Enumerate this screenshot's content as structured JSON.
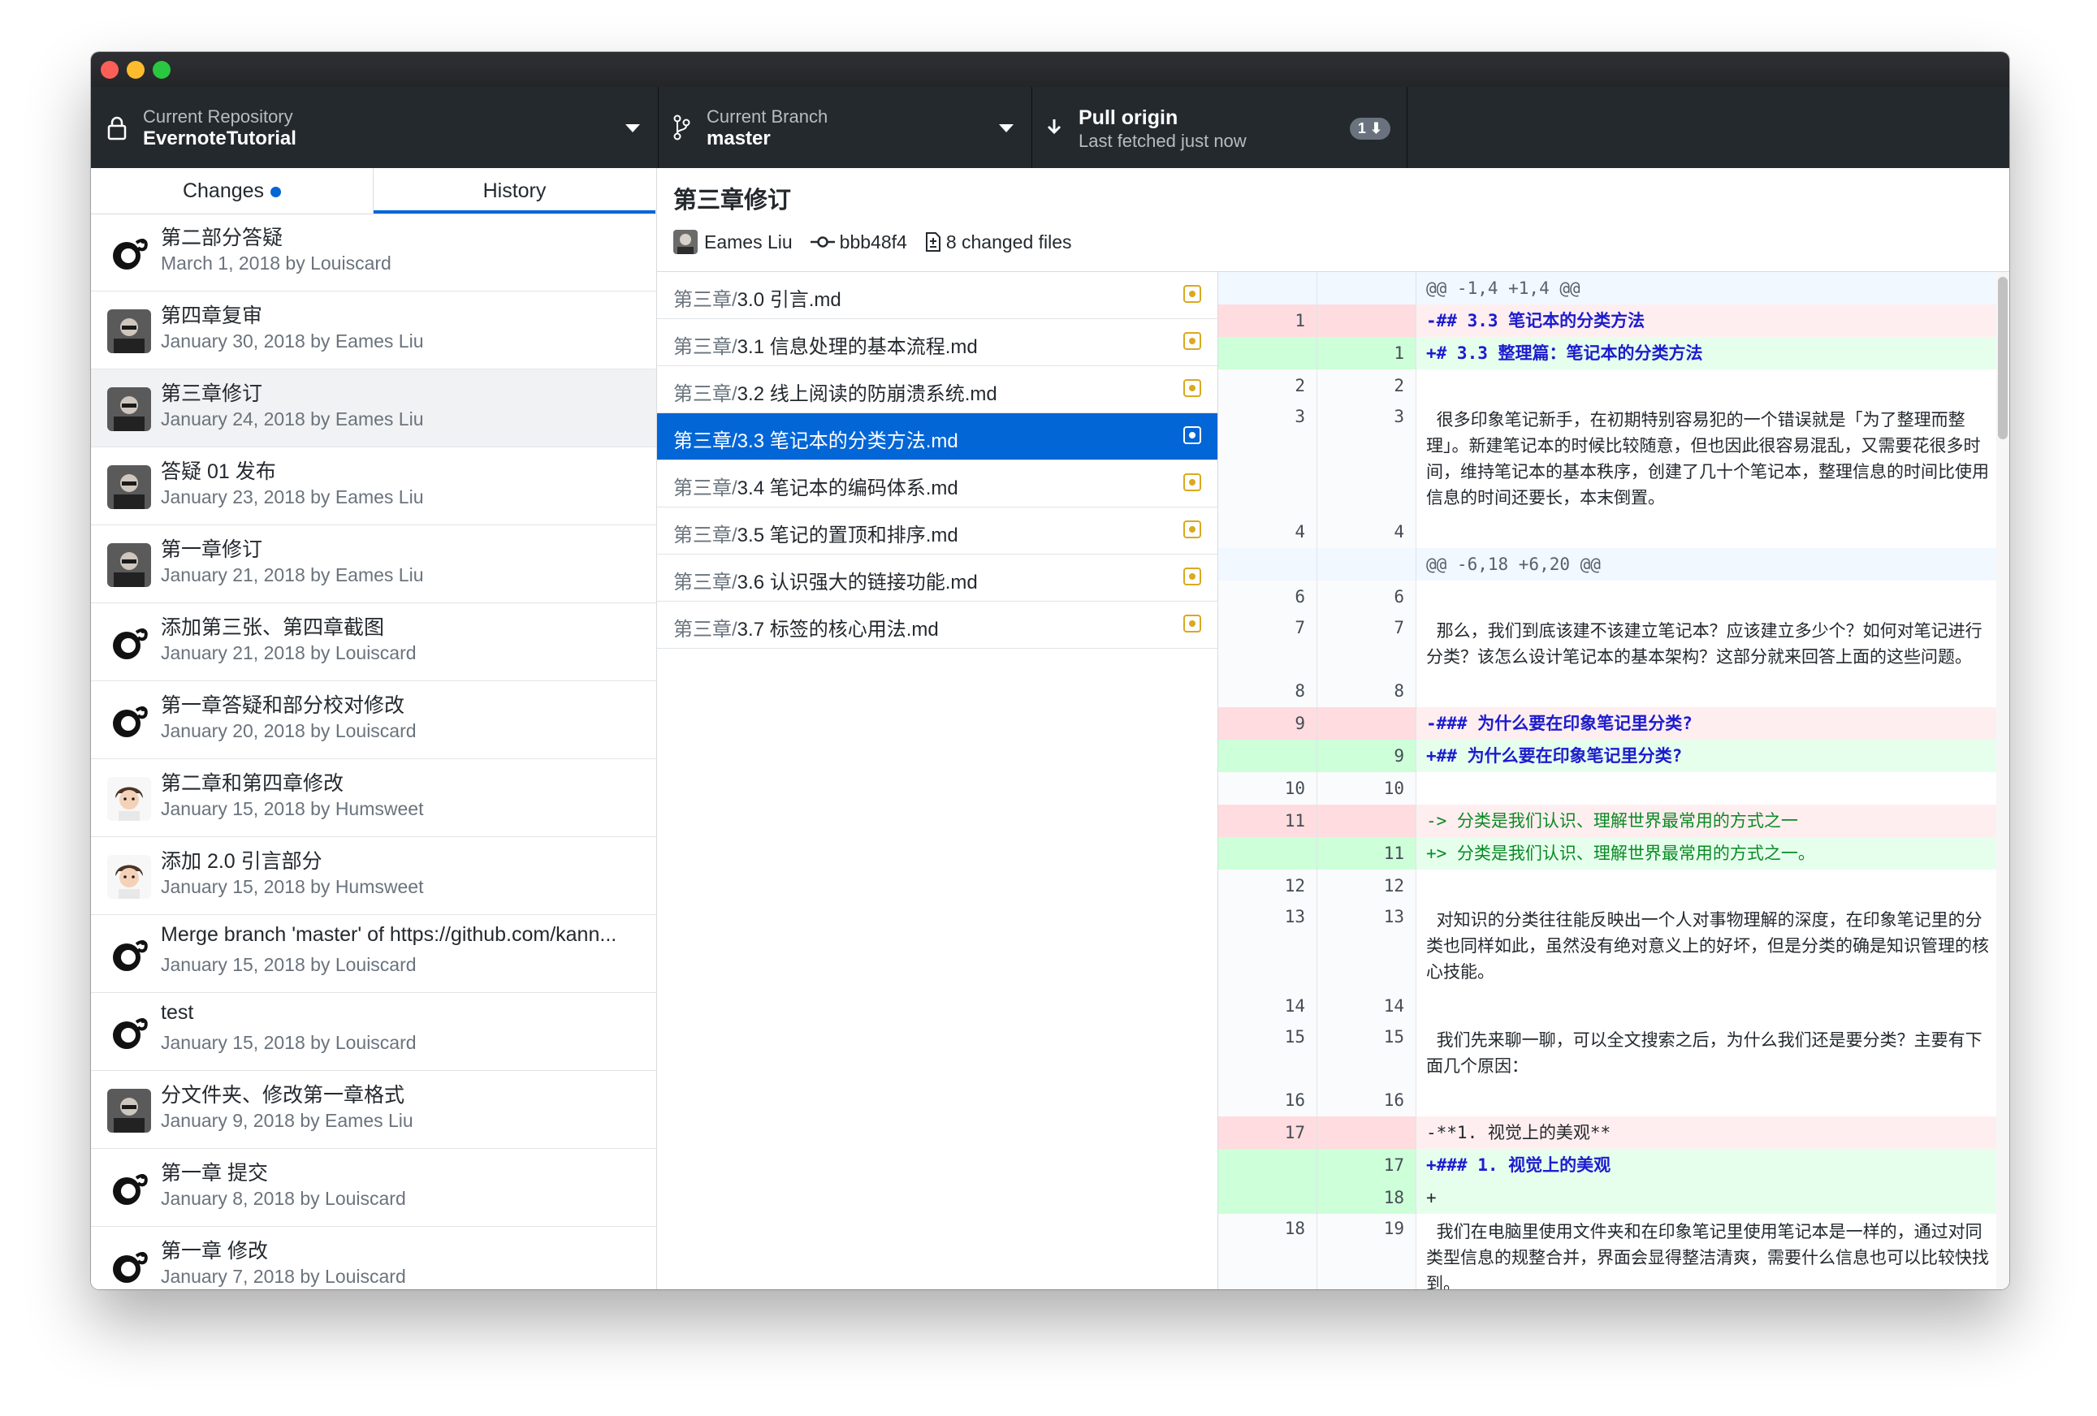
{
  "toolbar": {
    "repo_label": "Current Repository",
    "repo_value": "EvernoteTutorial",
    "branch_label": "Current Branch",
    "branch_value": "master",
    "pull_title": "Pull origin",
    "pull_subtitle": "Last fetched just now",
    "pull_badge": "1"
  },
  "sidebar": {
    "tabs": [
      {
        "label": "Changes"
      },
      {
        "label": "History"
      }
    ],
    "commits": [
      {
        "title": "第二部分答疑",
        "meta": "March 1, 2018 by Louiscard",
        "avatar": "octocat"
      },
      {
        "title": "第四章复审",
        "meta": "January 30, 2018 by Eames Liu",
        "avatar": "photo"
      },
      {
        "title": "第三章修订",
        "meta": "January 24, 2018 by Eames Liu",
        "avatar": "photo"
      },
      {
        "title": "答疑 01 发布",
        "meta": "January 23, 2018 by Eames Liu",
        "avatar": "photo"
      },
      {
        "title": "第一章修订",
        "meta": "January 21, 2018 by Eames Liu",
        "avatar": "photo"
      },
      {
        "title": "添加第三张、第四章截图",
        "meta": "January 21, 2018 by Louiscard",
        "avatar": "octocat"
      },
      {
        "title": "第一章答疑和部分校对修改",
        "meta": "January 20, 2018 by Louiscard",
        "avatar": "octocat"
      },
      {
        "title": "第二章和第四章修改",
        "meta": "January 15, 2018 by Humsweet",
        "avatar": "cartoon"
      },
      {
        "title": "添加 2.0 引言部分",
        "meta": "January 15, 2018 by Humsweet",
        "avatar": "cartoon"
      },
      {
        "title": "Merge branch 'master' of https://github.com/kann...",
        "meta": "January 15, 2018 by Louiscard",
        "avatar": "octocat"
      },
      {
        "title": "test",
        "meta": "January 15, 2018 by Louiscard",
        "avatar": "octocat"
      },
      {
        "title": "分文件夹、修改第一章格式",
        "meta": "January 9, 2018 by Eames Liu",
        "avatar": "photo"
      },
      {
        "title": "第一章 提交",
        "meta": "January 8, 2018 by Louiscard",
        "avatar": "octocat"
      },
      {
        "title": "第一章 修改",
        "meta": "January 7, 2018 by Louiscard",
        "avatar": "octocat"
      }
    ]
  },
  "commit_detail": {
    "title": "第三章修订",
    "author": "Eames Liu",
    "sha": "bbb48f4",
    "changed_files": "8 changed files"
  },
  "files": [
    {
      "dir": "第三章/",
      "name": "3.0 引言.md"
    },
    {
      "dir": "第三章/",
      "name": "3.1 信息处理的基本流程.md"
    },
    {
      "dir": "第三章/",
      "name": "3.2 线上阅读的防崩溃系统.md"
    },
    {
      "dir": "第三章/",
      "name": "3.3 笔记本的分类方法.md"
    },
    {
      "dir": "第三章/",
      "name": "3.4 笔记本的编码体系.md"
    },
    {
      "dir": "第三章/",
      "name": "3.5 笔记的置顶和排序.md"
    },
    {
      "dir": "第三章/",
      "name": "3.6 认识强大的链接功能.md"
    },
    {
      "dir": "第三章/",
      "name": "3.7 标签的核心用法.md"
    }
  ],
  "diff": [
    {
      "type": "hunk",
      "old": "",
      "new": "",
      "text": "@@ -1,4 +1,4 @@"
    },
    {
      "type": "del",
      "old": "1",
      "new": "",
      "text": "-## 3.3 笔记本的分类方法",
      "style": "blue"
    },
    {
      "type": "add",
      "old": "",
      "new": "1",
      "text": "+# 3.3 整理篇：笔记本的分类方法",
      "style": "blue"
    },
    {
      "type": "ctx",
      "old": "2",
      "new": "2",
      "text": ""
    },
    {
      "type": "ctx",
      "old": "3",
      "new": "3",
      "text": " 很多印象笔记新手，在初期特别容易犯的一个错误就是「为了整理而整理」。新建笔记本的时候比较随意，但也因此很容易混乱，又需要花很多时间，维持笔记本的基本秩序，创建了几十个笔记本，整理信息的时间比使用信息的时间还要长，本末倒置。"
    },
    {
      "type": "ctx",
      "old": "4",
      "new": "4",
      "text": ""
    },
    {
      "type": "hunk",
      "old": "",
      "new": "",
      "text": "@@ -6,18 +6,20 @@"
    },
    {
      "type": "ctx",
      "old": "6",
      "new": "6",
      "text": ""
    },
    {
      "type": "ctx",
      "old": "7",
      "new": "7",
      "text": " 那么，我们到底该建不该建立笔记本？应该建立多少个？如何对笔记进行分类？该怎么设计笔记本的基本架构？这部分就来回答上面的这些问题。"
    },
    {
      "type": "ctx",
      "old": "8",
      "new": "8",
      "text": ""
    },
    {
      "type": "del",
      "old": "9",
      "new": "",
      "text": "-### 为什么要在印象笔记里分类?",
      "style": "blue"
    },
    {
      "type": "add",
      "old": "",
      "new": "9",
      "text": "+## 为什么要在印象笔记里分类?",
      "style": "blue"
    },
    {
      "type": "ctx",
      "old": "10",
      "new": "10",
      "text": ""
    },
    {
      "type": "del",
      "old": "11",
      "new": "",
      "text": "-> 分类是我们认识、理解世界最常用的方式之一",
      "style": "green"
    },
    {
      "type": "add",
      "old": "",
      "new": "11",
      "text": "+> 分类是我们认识、理解世界最常用的方式之一。",
      "style": "green"
    },
    {
      "type": "ctx",
      "old": "12",
      "new": "12",
      "text": ""
    },
    {
      "type": "ctx",
      "old": "13",
      "new": "13",
      "text": " 对知识的分类往往能反映出一个人对事物理解的深度，在印象笔记里的分类也同样如此，虽然没有绝对意义上的好坏，但是分类的确是知识管理的核心技能。"
    },
    {
      "type": "ctx",
      "old": "14",
      "new": "14",
      "text": ""
    },
    {
      "type": "ctx",
      "old": "15",
      "new": "15",
      "text": " 我们先来聊一聊，可以全文搜索之后，为什么我们还是要分类？主要有下面几个原因："
    },
    {
      "type": "ctx",
      "old": "16",
      "new": "16",
      "text": ""
    },
    {
      "type": "del",
      "old": "17",
      "new": "",
      "text": "-**1. 视觉上的美观**"
    },
    {
      "type": "add",
      "old": "",
      "new": "17",
      "text": "+### 1. 视觉上的美观",
      "style": "blue"
    },
    {
      "type": "add",
      "old": "",
      "new": "18",
      "text": "+"
    },
    {
      "type": "ctx",
      "old": "18",
      "new": "19",
      "text": " 我们在电脑里使用文件夹和在印象笔记里使用笔记本是一样的，通过对同类型信息的规整合并，界面会显得整洁清爽，需要什么信息也可以比较快找到。"
    }
  ]
}
